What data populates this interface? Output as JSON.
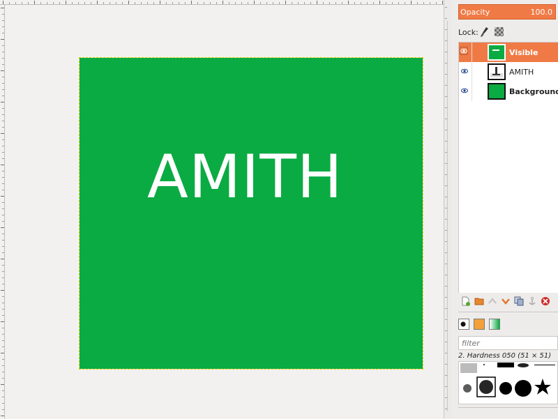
{
  "canvas": {
    "text": "AMITH",
    "fill_color": "#0aab42",
    "selection_color": "#e6d200"
  },
  "layers_panel": {
    "opacity_label": "Opacity",
    "opacity_value": "100.0",
    "lock_label": "Lock:",
    "layers": [
      {
        "name": "Visible",
        "selected": true,
        "bold": true
      },
      {
        "name": "AMITH",
        "selected": false,
        "bold": false
      },
      {
        "name": "Background",
        "selected": false,
        "bold": true
      }
    ]
  },
  "brushes_panel": {
    "filter_placeholder": "filter",
    "brush_name": "2. Hardness 050 (51 × 51)"
  },
  "colors": {
    "accent": "#f07a45",
    "green": "#0aab42"
  }
}
